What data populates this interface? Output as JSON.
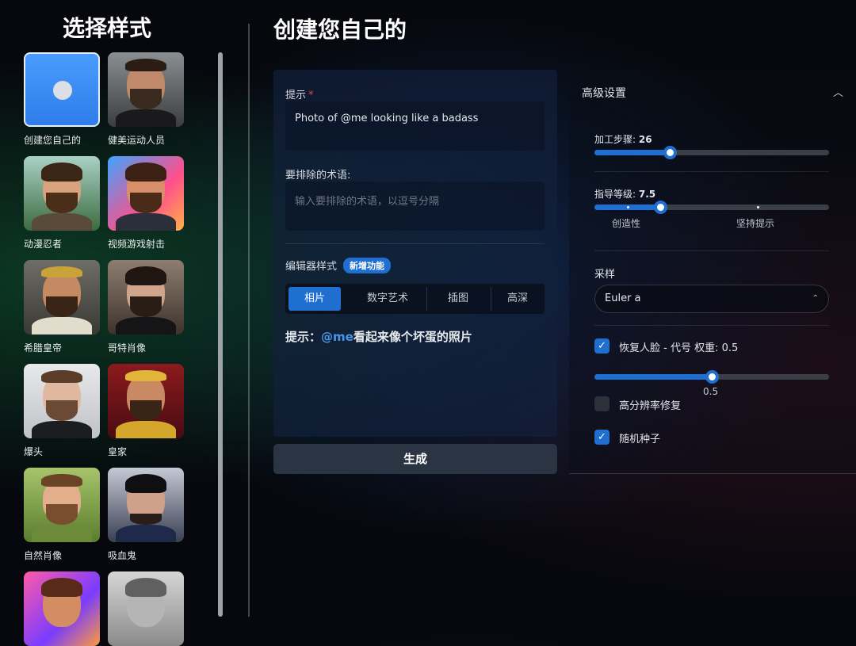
{
  "left": {
    "title": "选择样式",
    "styles": [
      {
        "label": "创建您自己的",
        "selected": true
      },
      {
        "label": "健美运动人员"
      },
      {
        "label": "动漫忍者"
      },
      {
        "label": "视频游戏射击"
      },
      {
        "label": "希腊皇帝"
      },
      {
        "label": "哥特肖像"
      },
      {
        "label": "爆头"
      },
      {
        "label": "皇家"
      },
      {
        "label": "自然肖像"
      },
      {
        "label": "吸血鬼"
      },
      {
        "label": ""
      },
      {
        "label": ""
      }
    ]
  },
  "main": {
    "title": "创建您自己的",
    "prompt_label": "提示",
    "required_mark": "*",
    "prompt_value": "Photo of @me looking like a badass",
    "negative_label": "要排除的术语:",
    "negative_placeholder": "输入要排除的术语，以逗号分隔",
    "editor_label": "编辑器样式",
    "new_badge": "新增功能",
    "editor_tabs": [
      "相片",
      "数字艺术",
      "插图",
      "高深"
    ],
    "active_tab": "相片",
    "hint_prefix": "提示：",
    "hint_me": "@me",
    "hint_rest": "看起来像个坏蛋的照片",
    "generate_label": "生成"
  },
  "advanced": {
    "title": "高级设置",
    "steps": {
      "label": "加工步骤:",
      "value": "26",
      "fraction": 0.32
    },
    "guidance": {
      "label": "指导等级:",
      "value": "7.5",
      "fraction": 0.28,
      "left_mark": "创造性",
      "right_mark": "坚持提示"
    },
    "sampling": {
      "label": "采样",
      "value": "Euler a"
    },
    "face_restore": {
      "label": "恢复人脸 - 代号 权重:",
      "value": "0.5",
      "checked": true,
      "fraction": 0.5,
      "value_label": "0.5"
    },
    "hires_fix": {
      "label": "高分辨率修复",
      "checked": false
    },
    "random_seed": {
      "label": "随机种子",
      "checked": true
    }
  },
  "colors": {
    "accent": "#1f6fd1",
    "badge": "#1f6fd1",
    "required": "#e0474d"
  }
}
